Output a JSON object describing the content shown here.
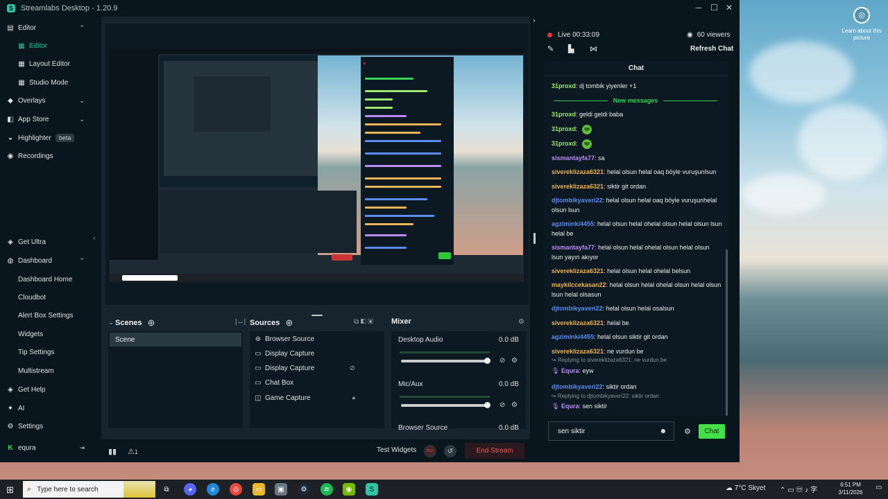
{
  "window": {
    "title": "Streamlabs Desktop - 1.20.9"
  },
  "desktop": {
    "learn_label": "Learn about this picture"
  },
  "sidebar": {
    "items": [
      {
        "label": "Editor",
        "icon": "editor-icon",
        "expanded": true
      },
      {
        "label": "Editor",
        "icon": "image-icon",
        "active": true
      },
      {
        "label": "Layout Editor",
        "icon": "layout-icon"
      },
      {
        "label": "Studio Mode",
        "icon": "studio-icon"
      },
      {
        "label": "Overlays",
        "icon": "overlays-icon",
        "expanded": false
      },
      {
        "label": "App Store",
        "icon": "store-icon",
        "expanded": false
      },
      {
        "label": "Highlighter",
        "icon": "highlighter-icon",
        "badge": "beta"
      },
      {
        "label": "Recordings",
        "icon": "recordings-icon"
      },
      {
        "label": "Get Ultra",
        "icon": "ultra-icon"
      },
      {
        "label": "Dashboard",
        "icon": "dashboard-icon",
        "expanded": true
      },
      {
        "label": "Dashboard Home"
      },
      {
        "label": "Cloudbot"
      },
      {
        "label": "Alert Box Settings"
      },
      {
        "label": "Widgets"
      },
      {
        "label": "Tip Settings"
      },
      {
        "label": "Multistream"
      },
      {
        "label": "Get Help",
        "icon": "help-icon"
      },
      {
        "label": "AI",
        "icon": "ai-icon"
      },
      {
        "label": "Settings",
        "icon": "gear-icon"
      },
      {
        "label": "equra",
        "icon": "kick-icon"
      }
    ]
  },
  "docks": {
    "scenes": {
      "title": "Scenes",
      "items": [
        "Scene"
      ]
    },
    "sources": {
      "title": "Sources",
      "items": [
        {
          "label": "Browser Source",
          "icon": "globe-icon"
        },
        {
          "label": "Display Capture",
          "icon": "monitor-icon"
        },
        {
          "label": "Display Capture",
          "icon": "monitor-icon",
          "hidden": true
        },
        {
          "label": "Chat Box",
          "icon": "chat-icon"
        },
        {
          "label": "Game Capture",
          "icon": "gamepad-icon",
          "locked": true
        }
      ]
    },
    "mixer": {
      "title": "Mixer",
      "channels": [
        {
          "label": "Desktop Audio",
          "value": "0.0 dB"
        },
        {
          "label": "Mic/Aux",
          "value": "0.0 dB"
        },
        {
          "label": "Browser Source",
          "value": "0.0 dB"
        }
      ]
    }
  },
  "footer": {
    "alert_count": "1",
    "test_widgets": "Test Widgets",
    "rec_label": "REC",
    "end_stream": "End Stream"
  },
  "chat_panel": {
    "live_label": "Live 00:33:09",
    "viewers": "60 viewers",
    "refresh": "Refresh Chat",
    "header": "Chat",
    "new_messages": "New messages",
    "messages": [
      {
        "user": "31proxd",
        "color": "#9fe870",
        "text": "dj tombik yiyenler +1"
      },
      {
        "user": "31proxd",
        "color": "#9fe870",
        "text": "geldi geldi baba"
      },
      {
        "user": "31proxd",
        "color": "#9fe870",
        "text": "",
        "emote": true
      },
      {
        "user": "31proxd",
        "color": "#9fe870",
        "text": "",
        "emote": true
      },
      {
        "user": "sismantayfa77",
        "color": "#b98cf7",
        "text": "sa"
      },
      {
        "user": "sivereklizaza6321",
        "color": "#f0b45a",
        "text": "helal olsun helal oaq böyle vuruşunlsun"
      },
      {
        "user": "sivereklizaza6321",
        "color": "#f0b45a",
        "text": "siktir git ordan"
      },
      {
        "user": "djtombikyaveri22",
        "color": "#5b8cf0",
        "text": "helal olsun helal oaq böyle vuruşunhelal olsun lsun"
      },
      {
        "user": "agziminki4455",
        "color": "#5b8cf0",
        "text": "helal olsun helal ohelal olsun helal olsun lsun helal be"
      },
      {
        "user": "sismantayfa77",
        "color": "#b98cf7",
        "text": "helal olsun helal ohelal olsun helal olsun lsun yayın akıyor"
      },
      {
        "user": "sivereklizaza6321",
        "color": "#f0b45a",
        "text": "helal olsun helal ohelal belsun"
      },
      {
        "user": "maykilccekasan22",
        "color": "#f0b45a",
        "text": "helal olsun helal ohelal olsun helal olsun lsun helal olsasun"
      },
      {
        "user": "djtombikyaveri22",
        "color": "#5b8cf0",
        "text": "helal olsun helal osalsun"
      },
      {
        "user": "sivereklizaza6321",
        "color": "#f0b45a",
        "text": "helal be"
      },
      {
        "user": "agziminki4455",
        "color": "#5b8cf0",
        "text": "helal olsun siktir git ordan"
      },
      {
        "user": "sivereklizaza6321",
        "color": "#f0b45a",
        "text": "ne vurdun be"
      },
      {
        "reply_to": "Replying to sivereklizaza6321: ne vurdun be",
        "user": "Equra",
        "color": "#b98cf7",
        "text": "eyw"
      },
      {
        "user": "djtombikyaveri22",
        "color": "#5b8cf0",
        "text": "siktir ordan"
      },
      {
        "reply_to": "Replying to djtombikyaveri22: siktir ordan",
        "user": "Equra",
        "color": "#b98cf7",
        "text": "sen siktir"
      }
    ],
    "input_value": "sen siktir",
    "send_label": "Chat"
  },
  "taskbar": {
    "search_placeholder": "Type here to search",
    "weather": "7°C Skyet",
    "time": "6:51 PM",
    "date": "3/11/2026"
  }
}
